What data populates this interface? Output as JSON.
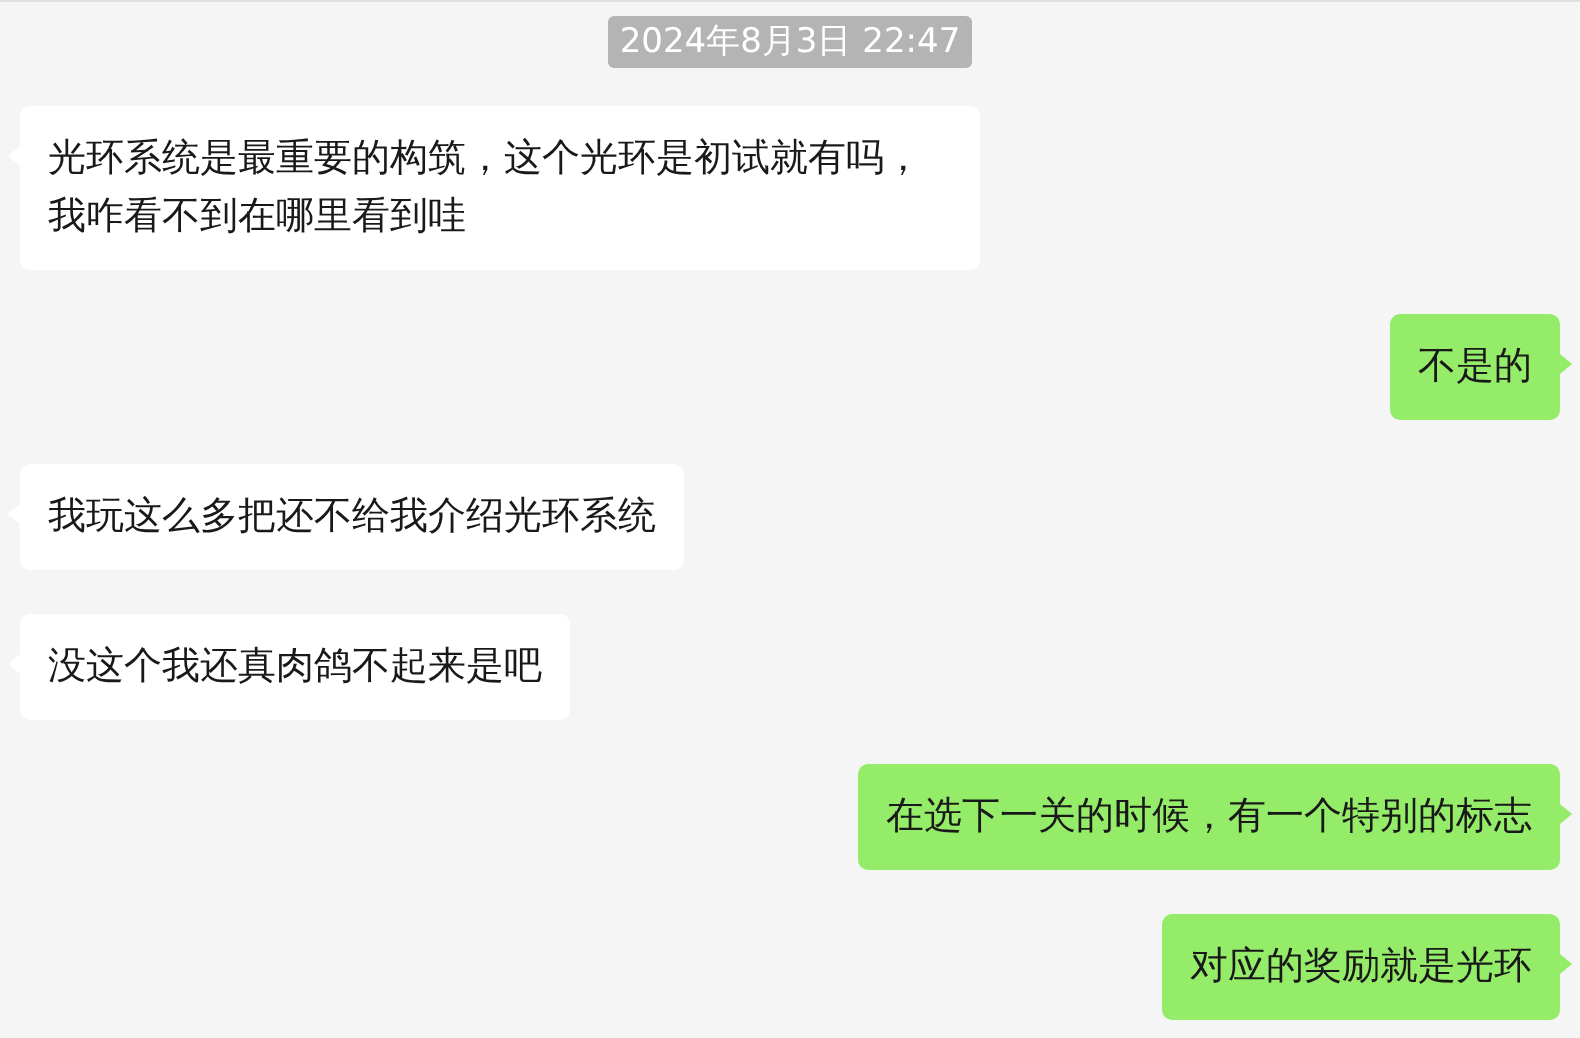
{
  "timestamp": "2024年8月3日 22:47",
  "messages": [
    {
      "kind": "received",
      "text": "光环系统是最重要的构筑，这个光环是初试就有吗，我咋看不到在哪里看到哇"
    },
    {
      "kind": "sent",
      "text": "不是的"
    },
    {
      "kind": "received",
      "text": "我玩这么多把还不给我介绍光环系统"
    },
    {
      "kind": "received",
      "text": "没这个我还真肉鸽不起来是吧"
    },
    {
      "kind": "sent",
      "text": "在选下一关的时候，有一个特别的标志"
    },
    {
      "kind": "sent",
      "text": "对应的奖励就是光环"
    }
  ]
}
